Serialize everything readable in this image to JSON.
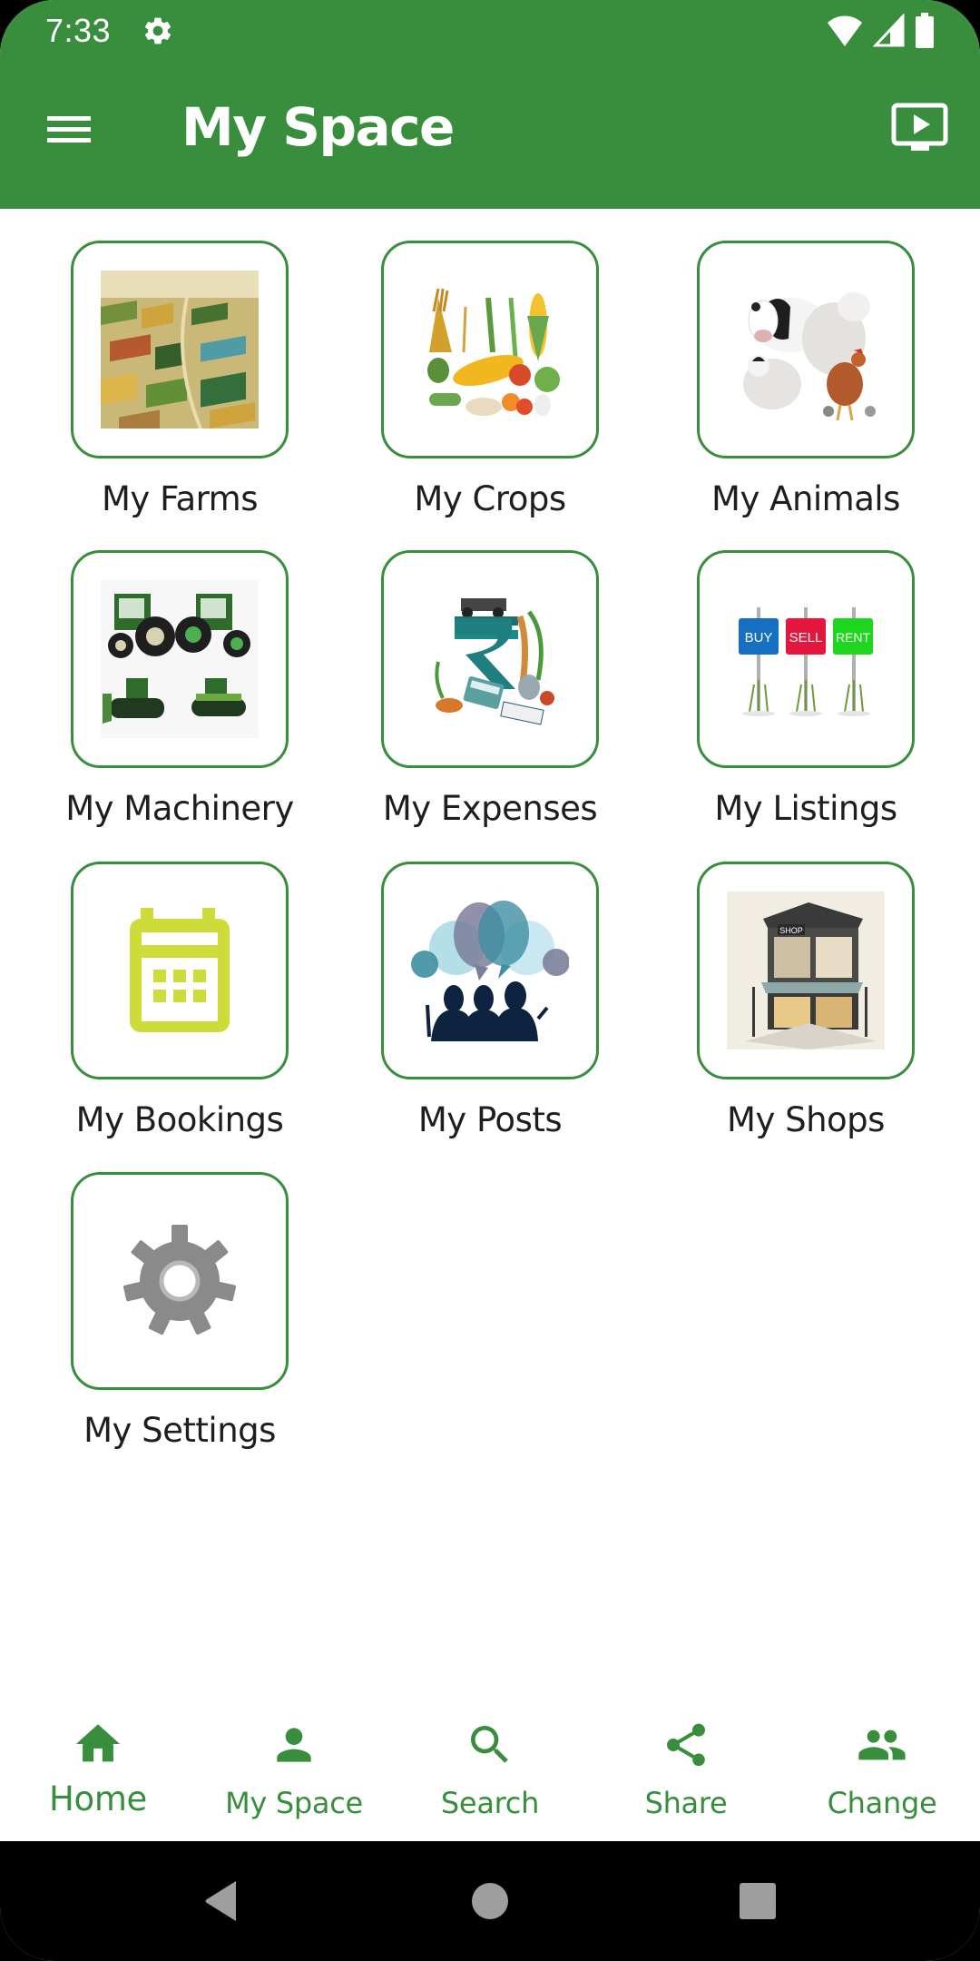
{
  "status_bar": {
    "time": "7:33",
    "left_icons": [
      "gear-icon"
    ],
    "right_icons": [
      "wifi-icon",
      "cellular-signal-icon",
      "battery-icon"
    ]
  },
  "app_bar": {
    "title": "My Space",
    "left_icon": "menu-icon",
    "right_icon": "tv-play-icon",
    "color": "#388E3C"
  },
  "grid": {
    "items": [
      {
        "label": "My Farms",
        "image": "aerial farmland fields"
      },
      {
        "label": "My Crops",
        "image": "assorted crops wheat corn vegetables"
      },
      {
        "label": "My Animals",
        "image": "cow sheep chicken"
      },
      {
        "label": "My Machinery",
        "image": "tractors and bulldozers"
      },
      {
        "label": "My Expenses",
        "image": "rupee symbol with farm produce"
      },
      {
        "label": "My Listings",
        "image": "buy sell rent signposts",
        "signs": [
          "BUY",
          "SELL",
          "RENT"
        ]
      },
      {
        "label": "My Bookings",
        "image": "calendar-icon"
      },
      {
        "label": "My Posts",
        "image": "people with speech bubbles"
      },
      {
        "label": "My Shops",
        "image": "shop storefront",
        "sign": "SHOP"
      },
      {
        "label": "My Settings",
        "image": "gear-icon"
      }
    ],
    "tile_border_color": "#388E3C"
  },
  "bottom_nav": {
    "active_index": 0,
    "items": [
      {
        "label": "Home",
        "icon": "home-icon"
      },
      {
        "label": "My Space",
        "icon": "person-icon"
      },
      {
        "label": "Search",
        "icon": "search-icon"
      },
      {
        "label": "Share",
        "icon": "share-icon"
      },
      {
        "label": "Change",
        "icon": "people-icon"
      }
    ],
    "color": "#388E3C"
  },
  "system_nav": {
    "buttons": [
      "back-icon",
      "home-circle-icon",
      "recents-icon"
    ]
  }
}
